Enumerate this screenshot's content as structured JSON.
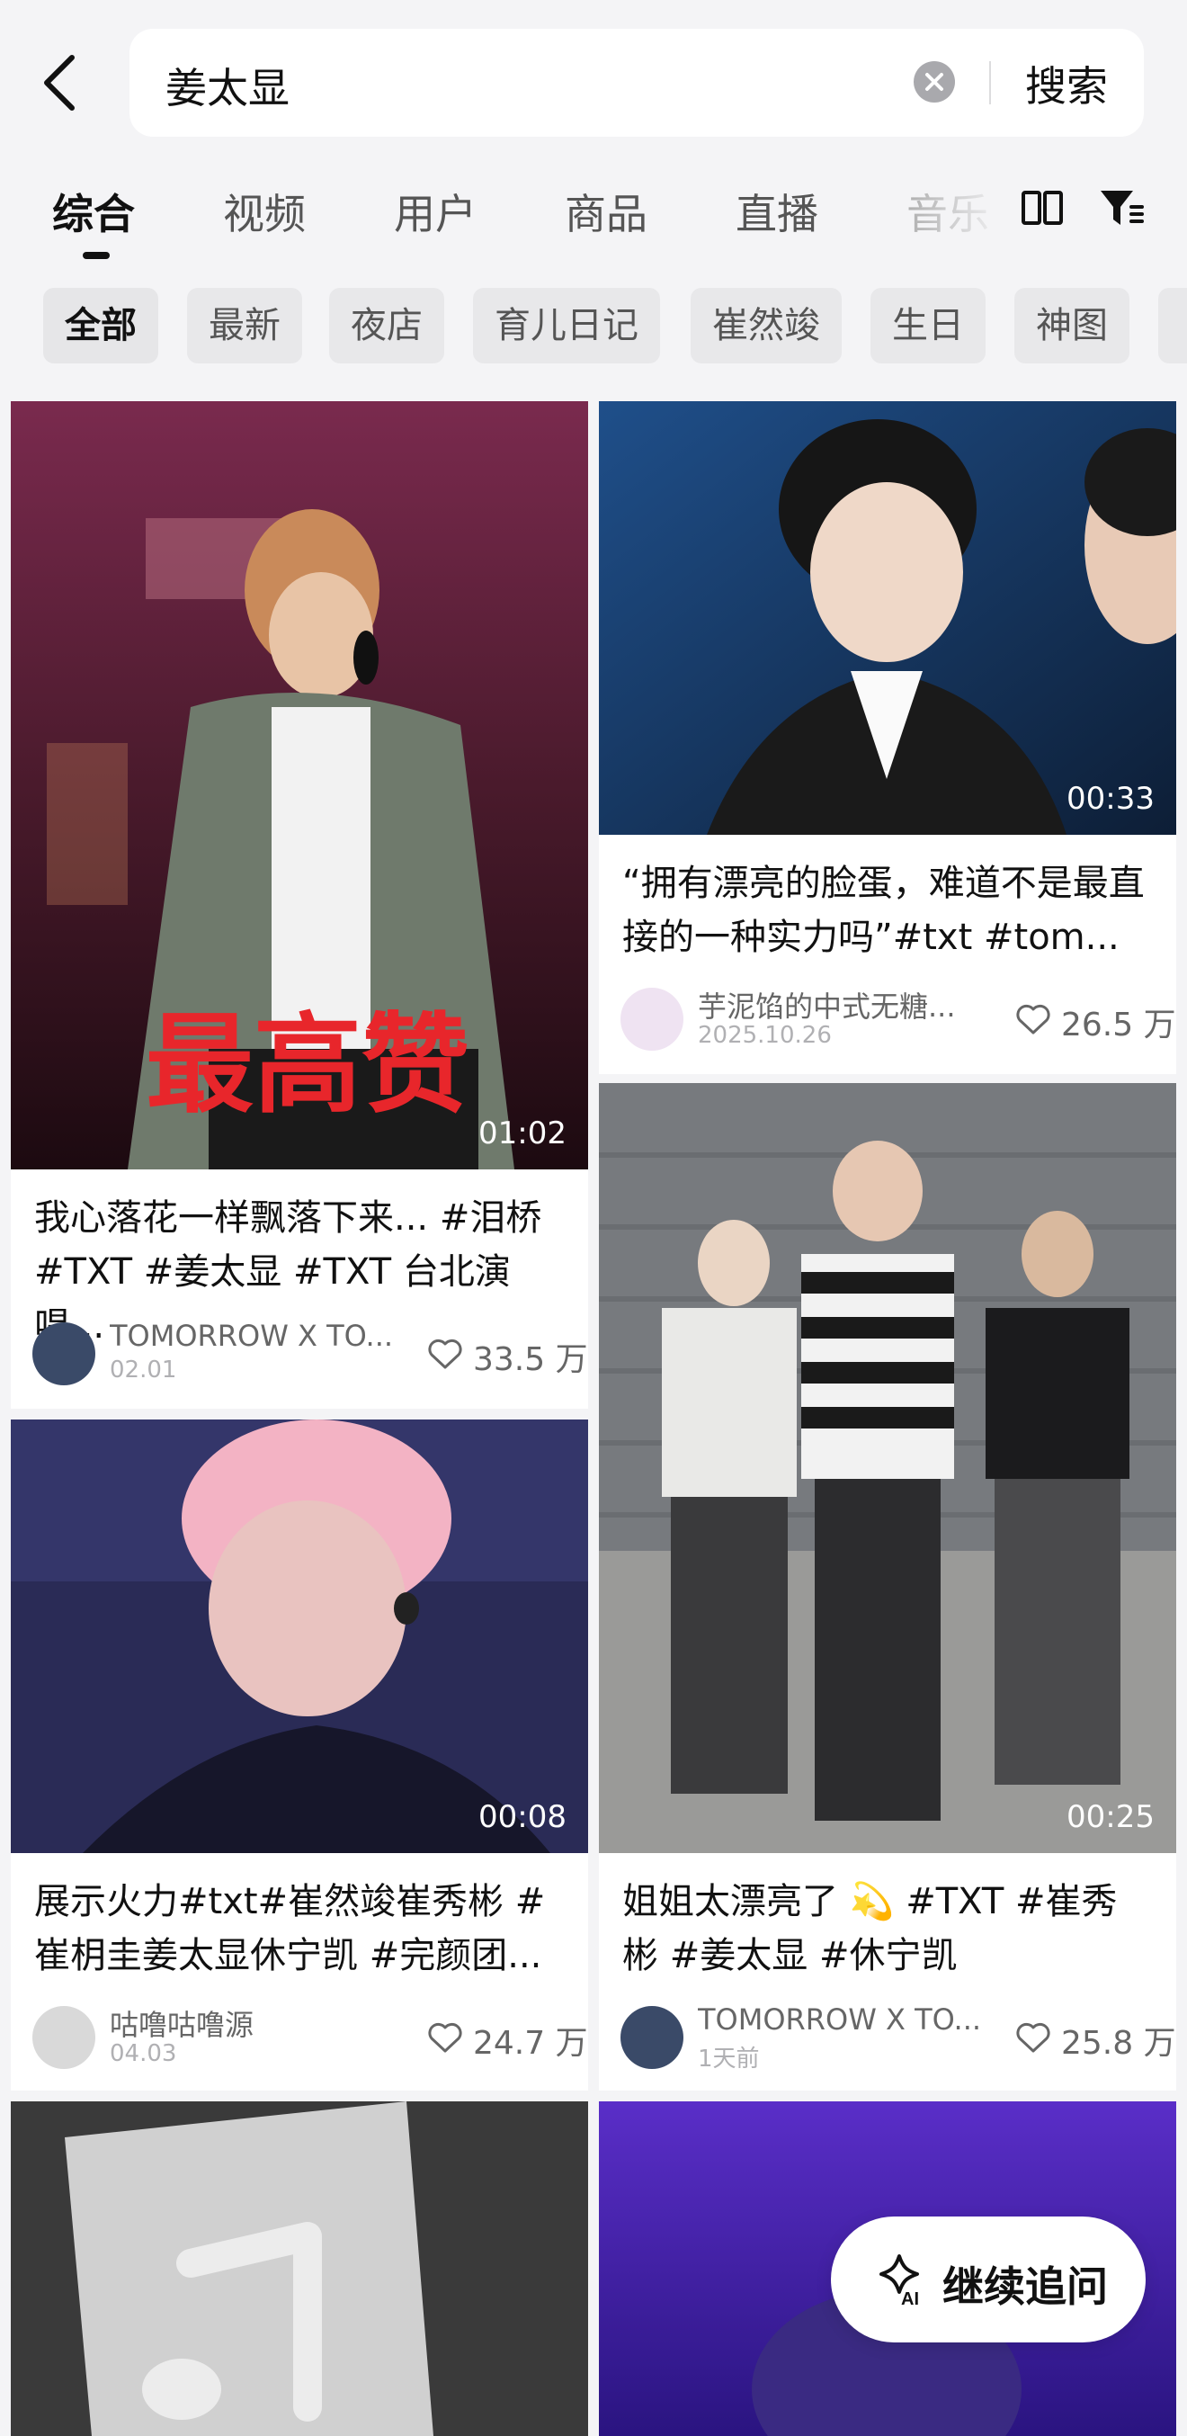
{
  "search": {
    "query": "姜太显",
    "button_label": "搜索"
  },
  "tabs": [
    {
      "label": "综合",
      "active": true
    },
    {
      "label": "视频"
    },
    {
      "label": "用户"
    },
    {
      "label": "商品"
    },
    {
      "label": "直播"
    },
    {
      "label": "音乐"
    }
  ],
  "chips": [
    {
      "label": "全部",
      "active": true
    },
    {
      "label": "最新"
    },
    {
      "label": "夜店"
    },
    {
      "label": "育儿日记"
    },
    {
      "label": "崔然竣"
    },
    {
      "label": "生日"
    },
    {
      "label": "神图"
    }
  ],
  "cards": [
    {
      "overlay_text": "最高赞",
      "duration": "01:02",
      "caption": "我心落花一样飘落下来... #泪桥 #TXT #姜太显 #TXT 台北演唱...",
      "author": "TOMORROW X TO...",
      "date": "02.01",
      "likes": "33.5 万"
    },
    {
      "duration": "00:33",
      "caption": "“拥有漂亮的脸蛋，难道不是最直接的一种实力吗”#txt #tom...",
      "author": "芋泥馅的中式无糖...",
      "date": "2025.10.26",
      "likes": "26.5 万"
    },
    {
      "duration": "00:08",
      "caption": "展示火力#txt#崔然竣崔秀彬 #崔枂圭姜太显休宁凯 #完颜团...",
      "author": "咕噜咕噜源",
      "date": "04.03",
      "likes": "24.7 万"
    },
    {
      "duration": "00:25",
      "caption": "姐姐太漂亮了 💫 #TXT #崔秀彬 #姜太显 #休宁凯",
      "author": "TOMORROW X TO...",
      "date": "1天前",
      "likes": "25.8 万"
    }
  ],
  "ai_button": {
    "label": "继续追问",
    "badge": "AI"
  },
  "colors": {
    "background": "#f4f4f6",
    "text_primary": "#111111",
    "text_secondary": "#666666",
    "overlay_red": "#e8262b"
  }
}
